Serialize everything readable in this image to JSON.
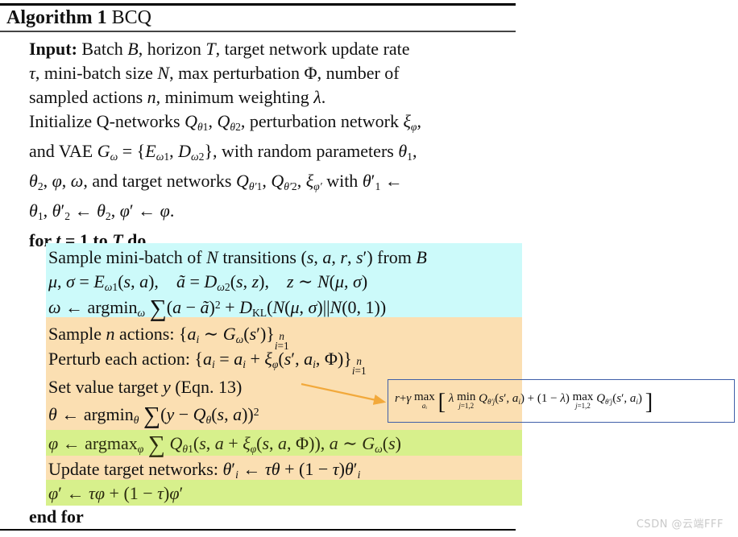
{
  "header": {
    "title_bold": "Algorithm 1",
    "title_rest": "BCQ"
  },
  "colors": {
    "highlight_cyan": "#CCFAFA",
    "highlight_orange": "#FBDFB2",
    "highlight_green": "#D7F08C",
    "box_border": "#3F5FA8",
    "arrow": "#F2A93B",
    "watermark": "#C9C9C9"
  },
  "preamble": {
    "input_label": "Input:",
    "line1": "Input: Batch B, horizon T, target network update rate",
    "line2": "τ, mini-batch size N, max perturbation Φ, number of",
    "line3": "sampled actions n, minimum weighting λ.",
    "line4": "Initialize Q-networks Q_θ1, Q_θ2, perturbation network ξ_φ,",
    "line5": "and VAE G_ω = {E_ω1, D_ω2}, with random parameters θ1,",
    "line6": "θ2, φ, ω, and target networks Q_θ'1, Q_θ'2, ξ_φ' with θ'1 ←",
    "line7": "θ1, θ'2 ← θ2, φ' ← φ."
  },
  "loop": {
    "for_line": "for t = 1 to T do",
    "end_line": "end for"
  },
  "steps": [
    {
      "id": "sample-minibatch",
      "highlight": "cyan",
      "text": "Sample mini-batch of N transitions (s, a, r, s') from B"
    },
    {
      "id": "vae-encode-decode",
      "highlight": "cyan",
      "text": "μ, σ = E_ω1(s, a),   ã = D_ω2(s, z),   z ~ N(μ, σ)"
    },
    {
      "id": "vae-objective",
      "highlight": "cyan",
      "text": "ω ← argmin_ω Σ(a − ã)² + D_KL(N(μ, σ)||N(0, 1))"
    },
    {
      "id": "sample-n-actions",
      "highlight": "orange",
      "text": "Sample n actions: {a_i ~ G_ω(s')}ⁿ_{i=1}"
    },
    {
      "id": "perturb-actions",
      "highlight": "orange",
      "text": "Perturb each action: {a_i = a_i + ξ_φ(s', a_i, Φ)}ⁿ_{i=1}"
    },
    {
      "id": "set-value-target",
      "highlight": "orange",
      "text": "Set value target y (Eqn. 13)"
    },
    {
      "id": "critic-update",
      "highlight": "orange",
      "text": "θ ← argmin_θ Σ(y − Q_θ(s, a))²"
    },
    {
      "id": "perturbation-update",
      "highlight": "green",
      "text": "φ ← argmax_φ Σ Q_θ1(s, a + ξ_φ(s, a, Φ)), a ~ G_ω(s)"
    },
    {
      "id": "update-target-networks",
      "highlight": "orange",
      "text": "Update target networks: θ'_i ← τθ + (1 − τ)θ'_i"
    },
    {
      "id": "update-target-perturbation",
      "highlight": "green",
      "text": "φ' ← τφ + (1 − τ)φ'"
    }
  ],
  "boxed_equation": {
    "reference": "Eqn. 13",
    "text": "r + γ max_{a_i} [ λ min_{j=1,2} Q_θ'j(s', a_i) + (1 − λ) max_{j=1,2} Q_θ'j(s', a_i) ]"
  },
  "watermark": {
    "text": "CSDN @云端FFF"
  }
}
